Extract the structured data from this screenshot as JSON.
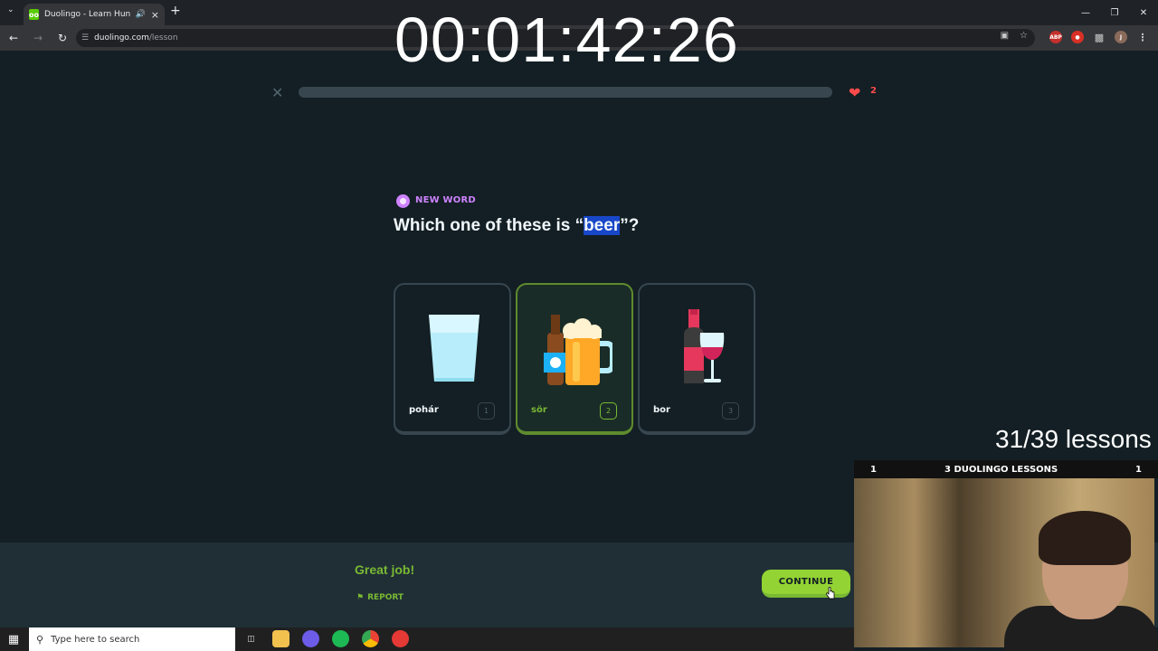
{
  "browser": {
    "tab_title": "Duolingo - Learn Hungarian",
    "favicon_letter": "oo",
    "url_domain": "duolingo.com",
    "url_path": "/lesson"
  },
  "stream": {
    "timer": "00:01:42:26",
    "lessons_count": "31/39 lessons",
    "cam_title": "3 DUOLINGO LESSONS",
    "cam_left_num": "1",
    "cam_right_num": "1"
  },
  "lesson": {
    "hearts": "2",
    "badge_label": "NEW WORD",
    "question_prefix": "Which one of these is “",
    "question_word": "beer",
    "question_suffix": "”?",
    "choices": [
      {
        "label": "pohár",
        "key": "1",
        "icon": "glass-icon"
      },
      {
        "label": "sör",
        "key": "2",
        "icon": "beer-icon"
      },
      {
        "label": "bor",
        "key": "3",
        "icon": "wine-icon"
      }
    ],
    "selected_index": 1
  },
  "footer": {
    "feedback": "Great job!",
    "report_label": "REPORT",
    "continue_label": "CONTINUE"
  },
  "taskbar": {
    "search_placeholder": "Type here to search"
  },
  "colors": {
    "background": "#131f24",
    "success_green": "#79b933",
    "button_green": "#93d333",
    "heart_red": "#ff4b4b",
    "new_word_purple": "#ce82ff",
    "highlight_blue": "#1847c9"
  }
}
